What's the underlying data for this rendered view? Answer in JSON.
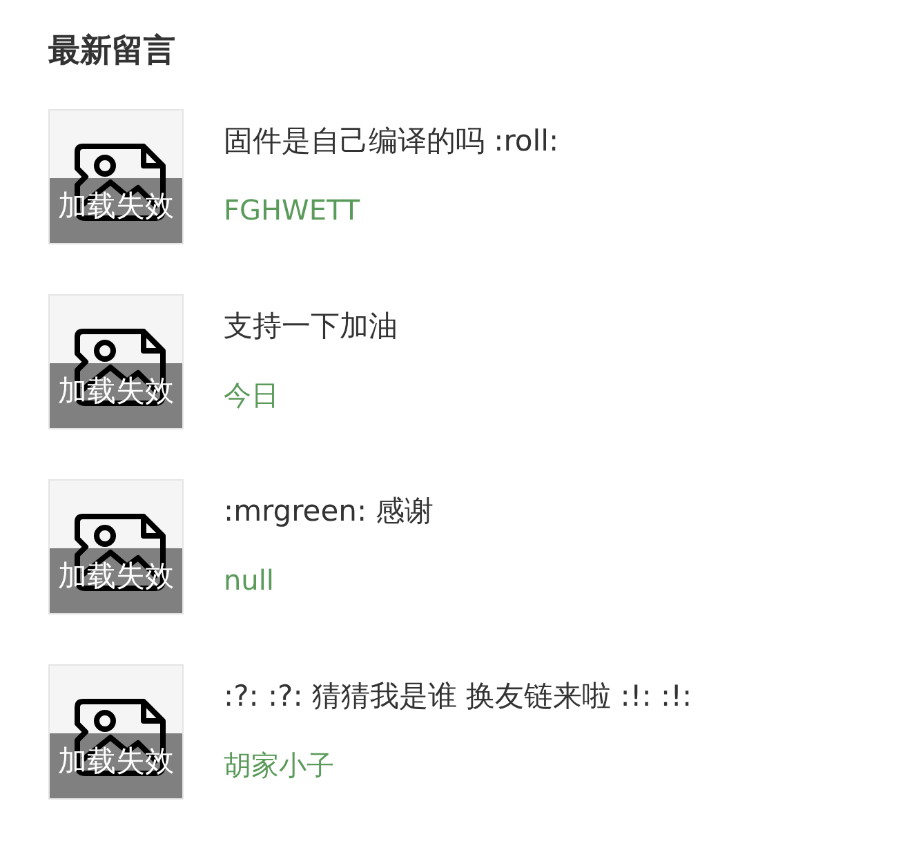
{
  "title": "最新留言",
  "comments": [
    {
      "image": {
        "alt_text": "加载失效"
      },
      "text": "固件是自己编译的吗 :roll:",
      "author": "FGHWETT"
    },
    {
      "image": {
        "alt_text": "加载失效"
      },
      "text": "支持一下加油",
      "author": "今日"
    },
    {
      "image": {
        "alt_text": "加载失效"
      },
      "text": ":mrgreen: 感谢",
      "author": "null"
    },
    {
      "image": {
        "alt_text": "加载失效"
      },
      "text": ":?: :?: 猜猜我是谁 换友链来啦 :!: :!:",
      "author": "胡家小子"
    }
  ]
}
